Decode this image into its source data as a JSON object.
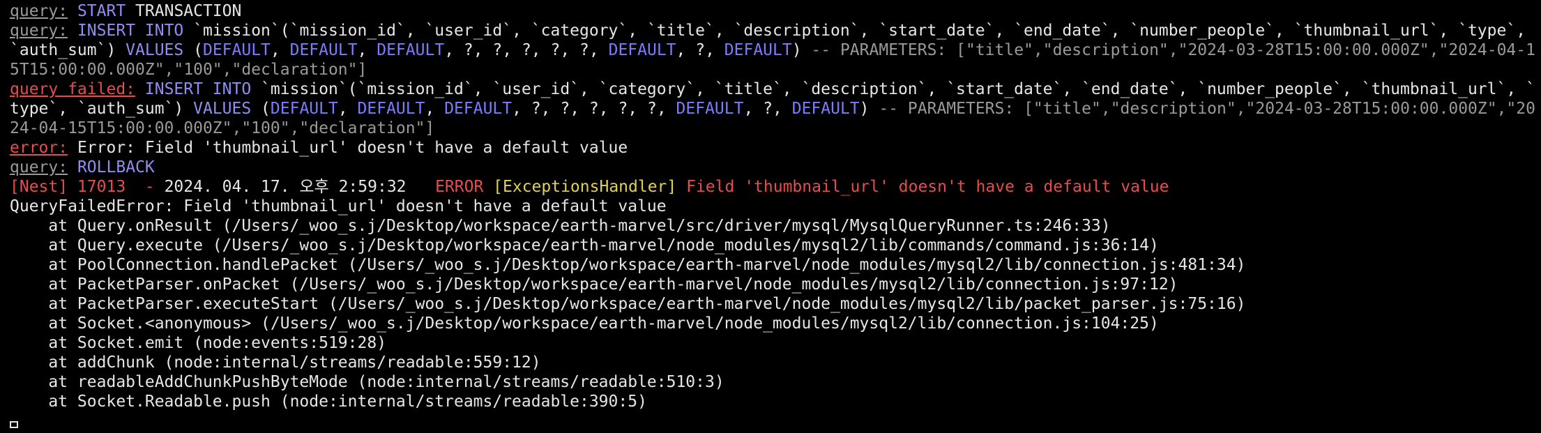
{
  "colors": {
    "background": "#000000",
    "text_default": "#e6e6e6",
    "query_label": "#9a9a9a",
    "sql_keyword": "#8f8ff0",
    "sql_default_keyword": "#7b7cff",
    "error_label": "#e84d4d",
    "comment": "#9a9a9a",
    "nest_red": "#e84d4d",
    "nest_yellow": "#e3d24c"
  },
  "lines": [
    {
      "segments": [
        {
          "text": "query:",
          "color": "#9a9a9a",
          "underline": true
        },
        {
          "text": " "
        },
        {
          "text": "START",
          "color": "#8f8ff0"
        },
        {
          "text": " TRANSACTION"
        }
      ]
    },
    {
      "segments": [
        {
          "text": "query:",
          "color": "#9a9a9a",
          "underline": true
        },
        {
          "text": " "
        },
        {
          "text": "INSERT INTO",
          "color": "#8f8ff0"
        },
        {
          "text": " `mission`(`mission_id`, `user_id`, `category`, `title`, `description`, `start_date`, `end_date`, `number_people`, `thumbnail_url`, `type`, `auth_sum`) "
        },
        {
          "text": "VALUES",
          "color": "#8f8ff0"
        },
        {
          "text": " ("
        },
        {
          "text": "DEFAULT",
          "color": "#7b7cff"
        },
        {
          "text": ", "
        },
        {
          "text": "DEFAULT",
          "color": "#7b7cff"
        },
        {
          "text": ", "
        },
        {
          "text": "DEFAULT",
          "color": "#7b7cff"
        },
        {
          "text": ", ?, ?, ?, ?, ?, "
        },
        {
          "text": "DEFAULT",
          "color": "#7b7cff"
        },
        {
          "text": ", ?, "
        },
        {
          "text": "DEFAULT",
          "color": "#7b7cff"
        },
        {
          "text": ") "
        },
        {
          "text": "-- PARAMETERS: [\"title\",\"description\",\"2024-03-28T15:00:00.000Z\",\"2024-04-15T15:00:00.000Z\",\"100\",\"declaration\"]",
          "color": "#9a9a9a"
        }
      ]
    },
    {
      "segments": [
        {
          "text": "query failed:",
          "color": "#e84d4d",
          "underline": true
        },
        {
          "text": " "
        },
        {
          "text": "INSERT INTO",
          "color": "#8f8ff0"
        },
        {
          "text": " `mission`(`mission_id`, `user_id`, `category`, `title`, `description`, `start_date`, `end_date`, `number_people`, `thumbnail_url`, `type`, `auth_sum`) "
        },
        {
          "text": "VALUES",
          "color": "#8f8ff0"
        },
        {
          "text": " ("
        },
        {
          "text": "DEFAULT",
          "color": "#7b7cff"
        },
        {
          "text": ", "
        },
        {
          "text": "DEFAULT",
          "color": "#7b7cff"
        },
        {
          "text": ", "
        },
        {
          "text": "DEFAULT",
          "color": "#7b7cff"
        },
        {
          "text": ", ?, ?, ?, ?, ?, "
        },
        {
          "text": "DEFAULT",
          "color": "#7b7cff"
        },
        {
          "text": ", ?, "
        },
        {
          "text": "DEFAULT",
          "color": "#7b7cff"
        },
        {
          "text": ") "
        },
        {
          "text": "-- PARAMETERS: [\"title\",\"description\",\"2024-03-28T15:00:00.000Z\",\"2024-04-15T15:00:00.000Z\",\"100\",\"declaration\"]",
          "color": "#9a9a9a"
        }
      ]
    },
    {
      "segments": [
        {
          "text": "error:",
          "color": "#e84d4d",
          "underline": true
        },
        {
          "text": " Error: Field 'thumbnail_url' doesn't have a default value"
        }
      ]
    },
    {
      "segments": [
        {
          "text": "query:",
          "color": "#9a9a9a",
          "underline": true
        },
        {
          "text": " "
        },
        {
          "text": "ROLLBACK",
          "color": "#8f8ff0"
        }
      ]
    },
    {
      "segments": [
        {
          "text": "[Nest] 17013  - ",
          "color": "#e84d4d"
        },
        {
          "text": "2024. 04. 17. 오후 2:59:32"
        },
        {
          "text": "   ERROR ",
          "color": "#e84d4d"
        },
        {
          "text": "[ExceptionsHandler]",
          "color": "#e3d24c"
        },
        {
          "text": " Field 'thumbnail_url' doesn't have a default value",
          "color": "#e84d4d"
        }
      ]
    },
    {
      "segments": [
        {
          "text": "QueryFailedError: Field 'thumbnail_url' doesn't have a default value"
        }
      ]
    },
    {
      "segments": [
        {
          "text": "    at Query.onResult (/Users/_woo_s.j/Desktop/workspace/earth-marvel/src/driver/mysql/MysqlQueryRunner.ts:246:33)"
        }
      ]
    },
    {
      "segments": [
        {
          "text": "    at Query.execute (/Users/_woo_s.j/Desktop/workspace/earth-marvel/node_modules/mysql2/lib/commands/command.js:36:14)"
        }
      ]
    },
    {
      "segments": [
        {
          "text": "    at PoolConnection.handlePacket (/Users/_woo_s.j/Desktop/workspace/earth-marvel/node_modules/mysql2/lib/connection.js:481:34)"
        }
      ]
    },
    {
      "segments": [
        {
          "text": "    at PacketParser.onPacket (/Users/_woo_s.j/Desktop/workspace/earth-marvel/node_modules/mysql2/lib/connection.js:97:12)"
        }
      ]
    },
    {
      "segments": [
        {
          "text": "    at PacketParser.executeStart (/Users/_woo_s.j/Desktop/workspace/earth-marvel/node_modules/mysql2/lib/packet_parser.js:75:16)"
        }
      ]
    },
    {
      "segments": [
        {
          "text": "    at Socket.<anonymous> (/Users/_woo_s.j/Desktop/workspace/earth-marvel/node_modules/mysql2/lib/connection.js:104:25)"
        }
      ]
    },
    {
      "segments": [
        {
          "text": "    at Socket.emit (node:events:519:28)"
        }
      ]
    },
    {
      "segments": [
        {
          "text": "    at addChunk (node:internal/streams/readable:559:12)"
        }
      ]
    },
    {
      "segments": [
        {
          "text": "    at readableAddChunkPushByteMode (node:internal/streams/readable:510:3)"
        }
      ]
    },
    {
      "segments": [
        {
          "text": "    at Socket.Readable.push (node:internal/streams/readable:390:5)"
        }
      ]
    }
  ],
  "cursor": {
    "shape": "hollow-block"
  }
}
